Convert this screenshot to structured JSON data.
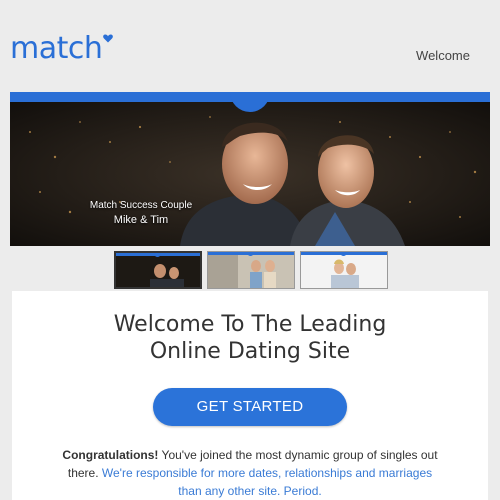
{
  "header": {
    "logo_text": "match",
    "welcome_link": "Welcome"
  },
  "banner": {
    "caption_line1": "Match Success Couple",
    "caption_line2": "Mike & Tim"
  },
  "thumbnails": [
    "slide-1",
    "slide-2",
    "slide-3"
  ],
  "main": {
    "title_line1": "Welcome To The Leading",
    "title_line2": "Online Dating Site",
    "cta_label": "GET STARTED",
    "body_bold": "Congratulations!",
    "body_plain": " You've joined the most dynamic group of singles out there. ",
    "body_link": "We're responsible for more dates, relationships and marriages than any other site. Period."
  },
  "colors": {
    "brand_blue": "#2a6fd6",
    "background": "#ececec",
    "card": "#ffffff"
  }
}
